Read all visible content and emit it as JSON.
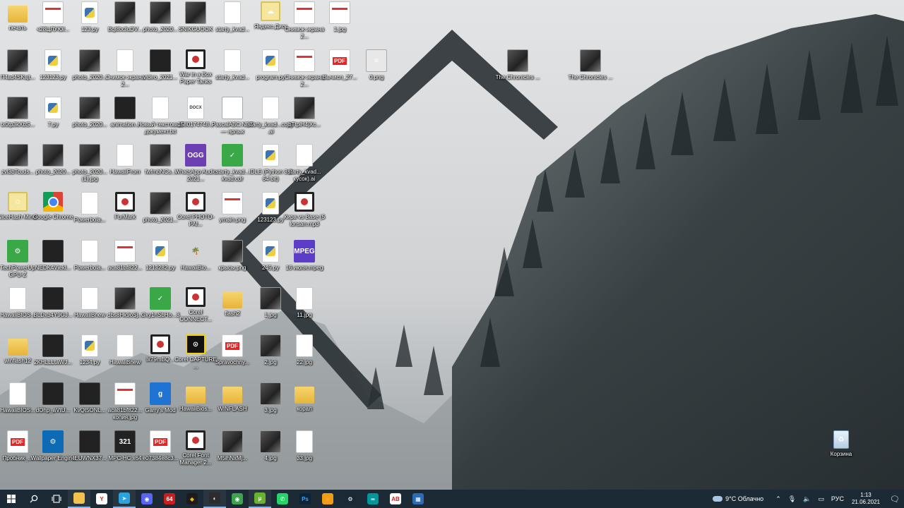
{
  "desktop": {
    "icons": [
      {
        "label": "печать",
        "kind": "folder",
        "glyph": ""
      },
      {
        "label": "ч28ЦЛУЮl...",
        "kind": "shot",
        "glyph": ""
      },
      {
        "label": "123.py",
        "kind": "py",
        "glyph": ""
      },
      {
        "label": "Bql8tx3uDV...",
        "kind": "photo",
        "glyph": ""
      },
      {
        "label": "photo_2020...",
        "kind": "photo",
        "glyph": ""
      },
      {
        "label": "SNIKGUOOK",
        "kind": "photo",
        "glyph": ""
      },
      {
        "label": "starty_kvad...",
        "kind": "file",
        "glyph": ""
      },
      {
        "label": "Яндекс.Диск",
        "kind": "smile",
        "glyph": "☁"
      },
      {
        "label": "Снимок экрана 2...",
        "kind": "shot",
        "glyph": ""
      },
      {
        "label": "1.jpg",
        "kind": "shot",
        "glyph": ""
      },
      {
        "label": "П4вd4SKsjt...",
        "kind": "photo",
        "glyph": ""
      },
      {
        "label": "123123.py",
        "kind": "py",
        "glyph": ""
      },
      {
        "label": "photo_2020...",
        "kind": "photo",
        "glyph": ""
      },
      {
        "label": "Снимок экрана 2...",
        "kind": "file",
        "glyph": ""
      },
      {
        "label": "video_2021...",
        "kind": "vid",
        "glyph": ""
      },
      {
        "label": "War in a Box Paper Tanks",
        "kind": "round",
        "glyph": ""
      },
      {
        "label": "starty_kvad...",
        "kind": "file",
        "glyph": ""
      },
      {
        "label": "program.py",
        "kind": "py",
        "glyph": ""
      },
      {
        "label": "Снимок экрана 2...",
        "kind": "shot",
        "glyph": ""
      },
      {
        "label": "Вычисл_27...",
        "kind": "pdf",
        "glyph": "PDF"
      },
      {
        "label": "0.png",
        "kind": "arch",
        "glyph": "≡"
      },
      {
        "label": "The Chronicles ...",
        "kind": "photo",
        "glyph": ""
      },
      {
        "label": "The Chronicles ...",
        "kind": "photo",
        "glyph": ""
      },
      {
        "label": "tx0tp3kXbS...",
        "kind": "photo",
        "glyph": ""
      },
      {
        "label": "7.py",
        "kind": "py",
        "glyph": ""
      },
      {
        "label": "photo_2020...",
        "kind": "photo",
        "glyph": ""
      },
      {
        "label": "animation...",
        "kind": "vid",
        "glyph": ""
      },
      {
        "label": "Новый текстовый документ.txt",
        "kind": "file",
        "glyph": ""
      },
      {
        "label": "1580174748...",
        "kind": "file",
        "glyph": "DOCX"
      },
      {
        "label": "PascalABC.NET — ярлык",
        "kind": "abc",
        "glyph": "ABC"
      },
      {
        "label": "starty_kvad...copy.ai",
        "kind": "file",
        "glyph": ""
      },
      {
        "label": "bTtplH4jXc...",
        "kind": "photo",
        "glyph": ""
      },
      {
        "label": "zvl3bTcuds...",
        "kind": "photo",
        "glyph": ""
      },
      {
        "label": "photo_2020...",
        "kind": "photo",
        "glyph": ""
      },
      {
        "label": "photo_2020... (1).jpg",
        "kind": "photo",
        "glyph": ""
      },
      {
        "label": "HawaiiFrom",
        "kind": "file",
        "glyph": ""
      },
      {
        "label": "fwfmbNCs...",
        "kind": "photo",
        "glyph": ""
      },
      {
        "label": "WhatsApp Audio 2021...",
        "kind": "ogg",
        "glyph": "OGG"
      },
      {
        "label": "starty_kvad... kvad.cdr",
        "kind": "green",
        "glyph": "✓"
      },
      {
        "label": "IDLE (Python 3.9 64-bit)",
        "kind": "py",
        "glyph": ""
      },
      {
        "label": "starty_kvad... кусок).ai",
        "kind": "file",
        "glyph": ""
      },
      {
        "label": "NiceHash Miner",
        "kind": "smile",
        "glyph": "☺"
      },
      {
        "label": "Google Chrome",
        "kind": "chrome",
        "glyph": ""
      },
      {
        "label": "Powerbola...",
        "kind": "file",
        "glyph": ""
      },
      {
        "label": "FurMark",
        "kind": "round",
        "glyph": ""
      },
      {
        "label": "photo_2021...",
        "kind": "photo",
        "glyph": ""
      },
      {
        "label": "Corel PHOTO-PAI...",
        "kind": "round",
        "glyph": ""
      },
      {
        "label": "ymain.png",
        "kind": "shot",
        "glyph": ""
      },
      {
        "label": "123123.py",
        "kind": "py",
        "glyph": ""
      },
      {
        "label": "Кира vs Base (5 lonsan.mp3",
        "kind": "round",
        "glyph": ""
      },
      {
        "label": "TechPowerUp GPU-Z",
        "kind": "green",
        "glyph": "⚙"
      },
      {
        "label": "NEDK4Viekl...",
        "kind": "speaker",
        "glyph": ""
      },
      {
        "label": "Powerbola...",
        "kind": "file",
        "glyph": ""
      },
      {
        "label": "aca81bf822...",
        "kind": "shot",
        "glyph": ""
      },
      {
        "label": "1213282.py",
        "kind": "py",
        "glyph": ""
      },
      {
        "label": "HawaiiBio...",
        "kind": "palm",
        "glyph": "🌴"
      },
      {
        "label": "крысы.png",
        "kind": "photo",
        "glyph": ""
      },
      {
        "label": "245.py",
        "kind": "py",
        "glyph": ""
      },
      {
        "label": "16 июля.mpeg",
        "kind": "mpeg",
        "glyph": "MPEG"
      },
      {
        "label": "HawaiiBIOS...",
        "kind": "file",
        "glyph": ""
      },
      {
        "label": "BLDxb4Y9GJ...",
        "kind": "speaker",
        "glyph": ""
      },
      {
        "label": "HawaiiBnew",
        "kind": "file",
        "glyph": ""
      },
      {
        "label": "dbs8Hk9oSj...",
        "kind": "photo",
        "glyph": ""
      },
      {
        "label": "Gxy1nSbHo...3",
        "kind": "green",
        "glyph": "✓"
      },
      {
        "label": "Corel CONNECT...",
        "kind": "round",
        "glyph": ""
      },
      {
        "label": "flash2",
        "kind": "folder",
        "glyph": ""
      },
      {
        "label": "1.jpg",
        "kind": "photo",
        "glyph": ""
      },
      {
        "label": "11.jpg",
        "kind": "file",
        "glyph": ""
      },
      {
        "label": "winflash12",
        "kind": "folder",
        "glyph": ""
      },
      {
        "label": "2KHLLLtaWJ...",
        "kind": "speaker",
        "glyph": ""
      },
      {
        "label": "1234.py",
        "kind": "py",
        "glyph": ""
      },
      {
        "label": "HawaiiBnew",
        "kind": "file",
        "glyph": ""
      },
      {
        "label": "lx79mBQ...",
        "kind": "round",
        "glyph": ""
      },
      {
        "label": "Corel CAPTURE ...",
        "kind": "corel",
        "glyph": "⊙"
      },
      {
        "label": "Spravochny...",
        "kind": "pdf",
        "glyph": "PDF"
      },
      {
        "label": "2.jpg",
        "kind": "photo",
        "glyph": ""
      },
      {
        "label": "22.jpg",
        "kind": "file",
        "glyph": ""
      },
      {
        "label": "HawaiiBIOS...",
        "kind": "file",
        "glyph": ""
      },
      {
        "label": "dOhp_aVtU...",
        "kind": "speaker",
        "glyph": ""
      },
      {
        "label": "KvQt5ONL...",
        "kind": "vid",
        "glyph": ""
      },
      {
        "label": "aca81bf822... копия.jpg",
        "kind": "shot",
        "glyph": ""
      },
      {
        "label": "Garry's Mod",
        "kind": "g",
        "glyph": "g"
      },
      {
        "label": "HawaiiBios...",
        "kind": "folder",
        "glyph": ""
      },
      {
        "label": "WINFLASH",
        "kind": "folder",
        "glyph": ""
      },
      {
        "label": "3.jpg",
        "kind": "photo",
        "glyph": ""
      },
      {
        "label": "корал",
        "kind": "folder",
        "glyph": ""
      },
      {
        "label": "Пробник_...",
        "kind": "pdf",
        "glyph": "PDF"
      },
      {
        "label": "Wallpaper Engine",
        "kind": "wall",
        "glyph": "⚙"
      },
      {
        "label": "IEUWNX37...",
        "kind": "vid",
        "glyph": ""
      },
      {
        "label": "MPC-HC x64",
        "kind": "vid",
        "glyph": "321"
      },
      {
        "label": "e07384e8c3...",
        "kind": "pdf",
        "glyph": "PDF"
      },
      {
        "label": "Corel Font Manager 2...",
        "kind": "round",
        "glyph": ""
      },
      {
        "label": "M5ihNxMj...",
        "kind": "photo",
        "glyph": ""
      },
      {
        "label": "4.jpg",
        "kind": "photo",
        "glyph": ""
      },
      {
        "label": "33.jpg",
        "kind": "file",
        "glyph": ""
      },
      {
        "label": "Корзина",
        "kind": "bin",
        "glyph": "♻"
      }
    ]
  },
  "taskbar": {
    "apps": [
      {
        "name": "explorer",
        "color": "#f2c14e",
        "glyph": ""
      },
      {
        "name": "yandex-browser",
        "color": "#ffffff",
        "glyph": "Y",
        "text": "#d22"
      },
      {
        "name": "telegram",
        "color": "#2aa3de",
        "glyph": "➤"
      },
      {
        "name": "discord",
        "color": "#5865f2",
        "glyph": "◉"
      },
      {
        "name": "aida64",
        "color": "#c81e1e",
        "glyph": "64"
      },
      {
        "name": "binance",
        "color": "#1c1c1c",
        "glyph": "◆",
        "text": "#f0b90b"
      },
      {
        "name": "app-circle",
        "color": "#2c2c2c",
        "glyph": "◐"
      },
      {
        "name": "app-green",
        "color": "#3fa34d",
        "glyph": "◉"
      },
      {
        "name": "utorrent",
        "color": "#69b32e",
        "glyph": "μ"
      },
      {
        "name": "whatsapp",
        "color": "#25d366",
        "glyph": "✆"
      },
      {
        "name": "photoshop",
        "color": "#0d2436",
        "glyph": "Ps",
        "text": "#31a8ff"
      },
      {
        "name": "app-orange",
        "color": "#f29b13",
        "glyph": "◌"
      },
      {
        "name": "steam",
        "color": "#1b2838",
        "glyph": "⚙"
      },
      {
        "name": "arduino",
        "color": "#00979d",
        "glyph": "∞"
      },
      {
        "name": "pascal",
        "color": "#ffffff",
        "glyph": "AB",
        "text": "#c22"
      },
      {
        "name": "calculator",
        "color": "#2b6cb5",
        "glyph": "▦"
      }
    ],
    "tray": {
      "weather": "9°C Облачно",
      "language": "РУС",
      "time": "1:13",
      "date": "21.06.2021"
    }
  }
}
